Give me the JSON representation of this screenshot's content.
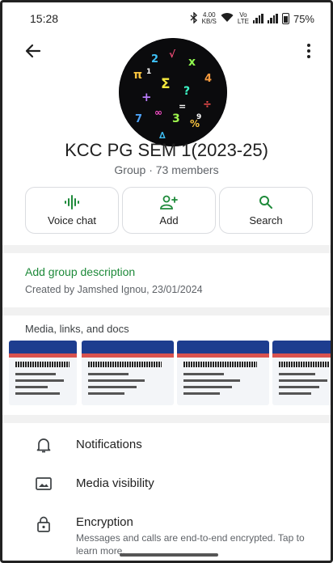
{
  "status_bar": {
    "time": "15:28",
    "bluetooth_icon": "bluetooth-icon",
    "data_speed_value": "4.00",
    "data_speed_unit": "KB/S",
    "wifi_icon": "wifi-icon",
    "volte_top": "Vo",
    "volte_bottom": "LTE",
    "battery": "75%"
  },
  "header": {
    "back_icon": "arrow-left-icon",
    "menu_icon": "more-vertical-icon"
  },
  "group": {
    "name": "KCC PG SEM 1(2023-25)",
    "subtitle": "Group · 73 members"
  },
  "actions": [
    {
      "label": "Voice chat",
      "icon": "voice-chat-icon"
    },
    {
      "label": "Add",
      "icon": "add-person-icon"
    },
    {
      "label": "Search",
      "icon": "search-icon"
    }
  ],
  "description": {
    "link": "Add group description",
    "created_by": "Created by Jamshed Ignou, 23/01/2024"
  },
  "media": {
    "title": "Media, links, and docs"
  },
  "settings": [
    {
      "title": "Notifications",
      "icon": "bell-icon"
    },
    {
      "title": "Media visibility",
      "icon": "image-icon"
    },
    {
      "title": "Encryption",
      "icon": "lock-icon",
      "subtitle": "Messages and calls are end-to-end encrypted. Tap to learn more."
    }
  ],
  "colors": {
    "accent": "#1e8a3a",
    "text": "#1f1f1f",
    "secondary_text": "#5f6368"
  }
}
